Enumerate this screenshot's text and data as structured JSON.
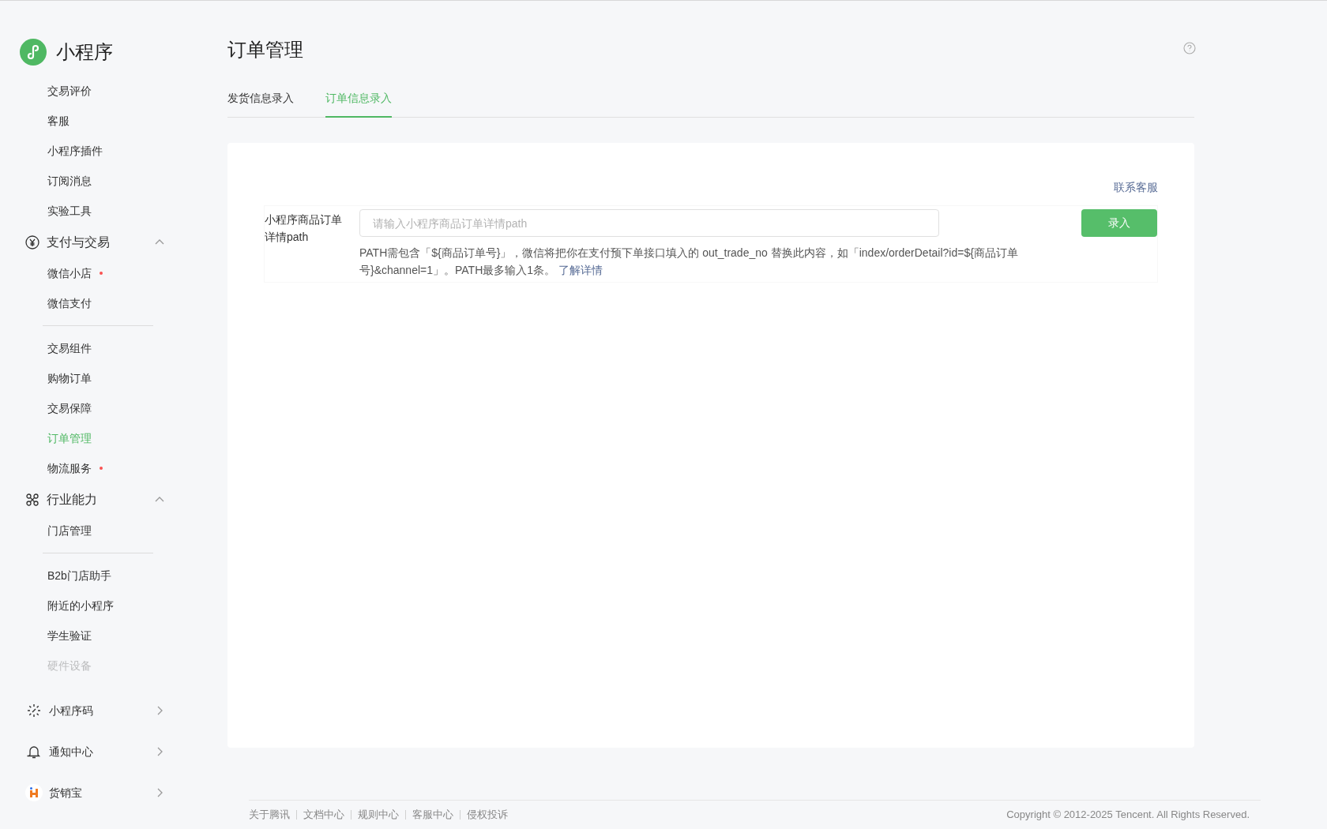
{
  "sidebar": {
    "brand": "小程序",
    "groups": [
      {
        "items": [
          {
            "label": "交易评价",
            "selected": false,
            "dot": false,
            "disabled": false
          },
          {
            "label": "客服",
            "selected": false,
            "dot": false,
            "disabled": false
          },
          {
            "label": "小程序插件",
            "selected": false,
            "dot": false,
            "disabled": false
          },
          {
            "label": "订阅消息",
            "selected": false,
            "dot": false,
            "disabled": false
          },
          {
            "label": "实验工具",
            "selected": false,
            "dot": false,
            "disabled": false
          }
        ]
      },
      {
        "title": "支付与交易",
        "expanded": true,
        "items": [
          {
            "label": "微信小店",
            "selected": false,
            "dot": true,
            "disabled": false
          },
          {
            "label": "微信支付",
            "selected": false,
            "dot": false,
            "disabled": false
          },
          {
            "kind": "divider"
          },
          {
            "label": "交易组件",
            "selected": false,
            "dot": false,
            "disabled": false
          },
          {
            "label": "购物订单",
            "selected": false,
            "dot": false,
            "disabled": false
          },
          {
            "label": "交易保障",
            "selected": false,
            "dot": false,
            "disabled": false
          },
          {
            "label": "订单管理",
            "selected": true,
            "dot": false,
            "disabled": false
          },
          {
            "label": "物流服务",
            "selected": false,
            "dot": true,
            "disabled": false
          }
        ]
      },
      {
        "title": "行业能力",
        "expanded": true,
        "items": [
          {
            "label": "门店管理",
            "selected": false,
            "dot": false,
            "disabled": false
          },
          {
            "kind": "divider"
          },
          {
            "label": "B2b门店助手",
            "selected": false,
            "dot": false,
            "disabled": false
          },
          {
            "label": "附近的小程序",
            "selected": false,
            "dot": false,
            "disabled": false
          },
          {
            "label": "学生验证",
            "selected": false,
            "dot": false,
            "disabled": false
          },
          {
            "label": "硬件设备",
            "selected": false,
            "dot": false,
            "disabled": true
          }
        ]
      }
    ],
    "bottom": [
      {
        "label": "小程序码"
      },
      {
        "label": "通知中心"
      },
      {
        "label": "货销宝"
      }
    ]
  },
  "page": {
    "title": "订单管理",
    "tabs": [
      {
        "label": "发货信息录入",
        "selected": false
      },
      {
        "label": "订单信息录入",
        "selected": true
      }
    ],
    "contact_link": "联系客服",
    "form": {
      "label": "小程序商品订单详情path",
      "placeholder": "请输入小程序商品订单详情path",
      "submit": "录入",
      "hint": "PATH需包含「${商品订单号}」，微信将把你在支付预下单接口填入的 out_trade_no 替换此内容，如「index/orderDetail?id=${商品订单号}&channel=1」。PATH最多输入1条。",
      "hint_link": "了解详情"
    }
  },
  "footer": {
    "links": [
      "关于腾讯",
      "文档中心",
      "规则中心",
      "客服中心",
      "侵权投诉"
    ],
    "copyright": "Copyright © 2012-2025 Tencent. All Rights Reserved."
  }
}
